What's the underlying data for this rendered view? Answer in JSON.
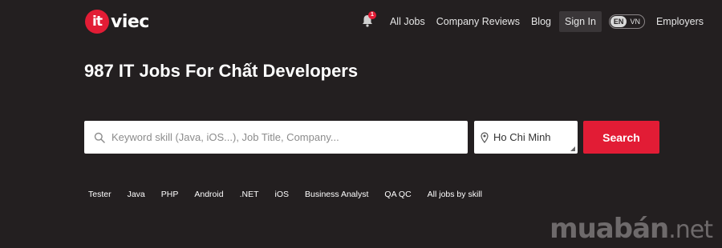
{
  "header": {
    "logo": {
      "mark": "it",
      "text": "viec"
    },
    "notification_count": "1",
    "nav": {
      "all_jobs": "All Jobs",
      "company_reviews": "Company Reviews",
      "blog": "Blog",
      "sign_in": "Sign In",
      "lang_en": "EN",
      "lang_vn": "VN",
      "employers": "Employers"
    }
  },
  "main": {
    "title": "987 IT Jobs For Chất Developers",
    "search": {
      "keyword_placeholder": "Keyword skill (Java, iOS...), Job Title, Company...",
      "city_value": "Ho Chi Minh",
      "button_label": "Search"
    },
    "skills": [
      "Tester",
      "Java",
      "PHP",
      "Android",
      ".NET",
      "iOS",
      "Business Analyst",
      "QA QC",
      "All jobs by skill"
    ]
  },
  "watermark": {
    "main": "muabán",
    "tld": ".net"
  },
  "colors": {
    "background": "#231f20",
    "accent": "#e21c35"
  },
  "icons": [
    "bell-icon",
    "search-icon",
    "map-pin-icon"
  ]
}
